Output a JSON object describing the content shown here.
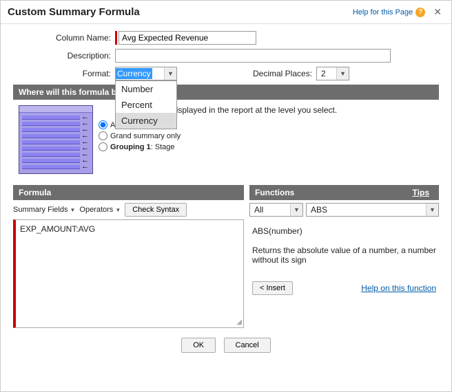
{
  "dialog": {
    "title": "Custom Summary Formula",
    "help_link": "Help for this Page"
  },
  "form": {
    "column_name_label": "Column Name:",
    "column_name_value": "Avg Expected Revenue",
    "description_label": "Description:",
    "description_value": "",
    "format_label": "Format:",
    "format_value": "Currency",
    "format_options": [
      "Number",
      "Percent",
      "Currency"
    ],
    "decimal_label": "Decimal Places:",
    "decimal_value": "2"
  },
  "where": {
    "header": "Where will this formula b",
    "note": "ation will be displayed in the report at the level you select.",
    "radios": {
      "all": "All summary levels",
      "grand": "Grand summary only",
      "grouping_label": "Grouping 1",
      "grouping_value": ": Stage"
    }
  },
  "formula": {
    "header": "Formula",
    "summary_fields": "Summary Fields",
    "operators": "Operators",
    "check_syntax": "Check Syntax",
    "body": "EXP_AMOUNT:AVG"
  },
  "functions": {
    "header": "Functions",
    "tips": "Tips",
    "category_value": "All",
    "selected_value": "ABS",
    "signature": "ABS(number)",
    "description": "Returns the absolute value of a number, a number without its sign",
    "insert_btn": "< Insert",
    "help_link": "Help on this function"
  },
  "buttons": {
    "ok": "OK",
    "cancel": "Cancel"
  }
}
